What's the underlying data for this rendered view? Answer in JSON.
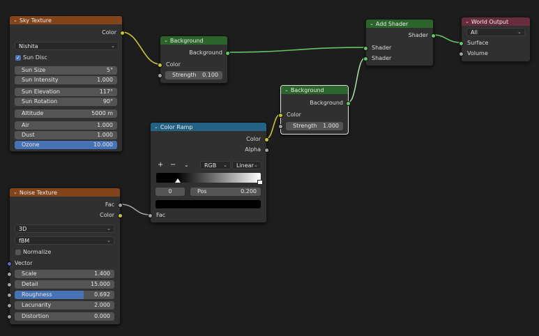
{
  "sky": {
    "title": "Sky Texture",
    "out_color": "Color",
    "sky_type": "Nishita",
    "sun_disc": "Sun Disc",
    "sun_size": {
      "label": "Sun Size",
      "value": "5°"
    },
    "sun_intensity": {
      "label": "Sun Intensity",
      "value": "1.000"
    },
    "sun_elevation": {
      "label": "Sun Elevation",
      "value": "117°"
    },
    "sun_rotation": {
      "label": "Sun Rotation",
      "value": "90°"
    },
    "altitude": {
      "label": "Altitude",
      "value": "5000 m"
    },
    "air": {
      "label": "Air",
      "value": "1.000"
    },
    "dust": {
      "label": "Dust",
      "value": "1.000"
    },
    "ozone": {
      "label": "Ozone",
      "value": "10.000"
    }
  },
  "bg1": {
    "title": "Background",
    "out": "Background",
    "in_color": "Color",
    "strength": {
      "label": "Strength",
      "value": "0.100"
    }
  },
  "bg2": {
    "title": "Background",
    "out": "Background",
    "in_color": "Color",
    "strength": {
      "label": "Strength",
      "value": "1.000"
    }
  },
  "add": {
    "title": "Add Shader",
    "out": "Shader",
    "in1": "Shader",
    "in2": "Shader"
  },
  "world": {
    "title": "World Output",
    "target": "All",
    "surface": "Surface",
    "volume": "Volume"
  },
  "ramp": {
    "title": "Color Ramp",
    "out_color": "Color",
    "out_alpha": "Alpha",
    "add": "+",
    "remove": "−",
    "menu": "⌄",
    "color_mode": "RGB",
    "interpolation": "Linear",
    "index": "0",
    "pos_label": "Pos",
    "pos_value": "0.200",
    "in_fac": "Fac"
  },
  "noise": {
    "title": "Noise Texture",
    "out_fac": "Fac",
    "out_color": "Color",
    "dimensions": "3D",
    "type": "fBM",
    "normalize": "Normalize",
    "vector": "Vector",
    "scale": {
      "label": "Scale",
      "value": "1.400"
    },
    "detail": {
      "label": "Detail",
      "value": "15.000"
    },
    "roughness": {
      "label": "Roughness",
      "value": "0.692",
      "fraction": 0.692
    },
    "lacunarity": {
      "label": "Lacunarity",
      "value": "2.000"
    },
    "distortion": {
      "label": "Distortion",
      "value": "0.000"
    }
  },
  "colors": {
    "input_header": "#83431b",
    "shader_header": "#2b652b",
    "converter_header": "#246283",
    "output_header": "#672c3d",
    "color_socket": "#c7c729",
    "shader_socket": "#63c763",
    "float_socket": "#a1a1a1",
    "vector_socket": "#6363c7"
  }
}
